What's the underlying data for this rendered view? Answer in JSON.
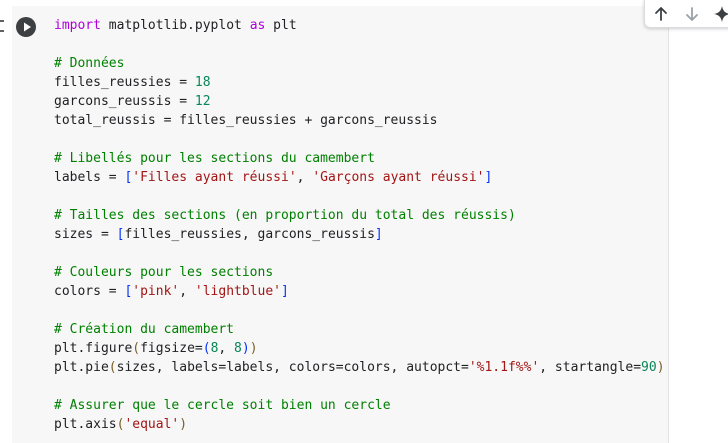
{
  "colors": {
    "cell_background": "#f7f7f7",
    "keyword": "#af00db",
    "comment": "#008000",
    "number": "#098658",
    "string": "#a31515",
    "bracket": "#0431fa",
    "paren": "#795e26"
  },
  "toolbar": {
    "icons": [
      "arrow-up-icon",
      "arrow-down-icon",
      "sparkle-icon"
    ]
  },
  "cell": {
    "run_icon": "play-icon",
    "code_lines": [
      [
        {
          "t": "kw",
          "v": "import"
        },
        {
          "t": "op",
          "v": " matplotlib.pyplot "
        },
        {
          "t": "kw",
          "v": "as"
        },
        {
          "t": "op",
          "v": " plt"
        }
      ],
      [],
      [
        {
          "t": "comment",
          "v": "# Données"
        }
      ],
      [
        {
          "t": "op",
          "v": "filles_reussies = "
        },
        {
          "t": "num",
          "v": "18"
        }
      ],
      [
        {
          "t": "op",
          "v": "garcons_reussis = "
        },
        {
          "t": "num",
          "v": "12"
        }
      ],
      [
        {
          "t": "op",
          "v": "total_reussis = filles_reussies + garcons_reussis"
        }
      ],
      [],
      [
        {
          "t": "comment",
          "v": "# Libellés pour les sections du camembert"
        }
      ],
      [
        {
          "t": "op",
          "v": "labels = "
        },
        {
          "t": "bracket",
          "v": "["
        },
        {
          "t": "str",
          "v": "'Filles ayant réussi'"
        },
        {
          "t": "op",
          "v": ", "
        },
        {
          "t": "str",
          "v": "'Garçons ayant réussi'"
        },
        {
          "t": "bracket",
          "v": "]"
        }
      ],
      [],
      [
        {
          "t": "comment",
          "v": "# Tailles des sections (en proportion du total des réussis)"
        }
      ],
      [
        {
          "t": "op",
          "v": "sizes = "
        },
        {
          "t": "bracket",
          "v": "["
        },
        {
          "t": "op",
          "v": "filles_reussies, garcons_reussis"
        },
        {
          "t": "bracket",
          "v": "]"
        }
      ],
      [],
      [
        {
          "t": "comment",
          "v": "# Couleurs pour les sections"
        }
      ],
      [
        {
          "t": "op",
          "v": "colors = "
        },
        {
          "t": "bracket",
          "v": "["
        },
        {
          "t": "str",
          "v": "'pink'"
        },
        {
          "t": "op",
          "v": ", "
        },
        {
          "t": "str",
          "v": "'lightblue'"
        },
        {
          "t": "bracket",
          "v": "]"
        }
      ],
      [],
      [
        {
          "t": "comment",
          "v": "# Création du camembert"
        }
      ],
      [
        {
          "t": "op",
          "v": "plt.figure"
        },
        {
          "t": "paren",
          "v": "("
        },
        {
          "t": "op",
          "v": "figsize="
        },
        {
          "t": "bracket",
          "v": "("
        },
        {
          "t": "num",
          "v": "8"
        },
        {
          "t": "op",
          "v": ", "
        },
        {
          "t": "num",
          "v": "8"
        },
        {
          "t": "bracket",
          "v": ")"
        },
        {
          "t": "paren",
          "v": ")"
        }
      ],
      [
        {
          "t": "op",
          "v": "plt.pie"
        },
        {
          "t": "paren",
          "v": "("
        },
        {
          "t": "op",
          "v": "sizes, labels=labels, colors=colors, autopct="
        },
        {
          "t": "str",
          "v": "'%1.1f%%'"
        },
        {
          "t": "op",
          "v": ", startangle="
        },
        {
          "t": "num",
          "v": "90"
        },
        {
          "t": "paren",
          "v": ")"
        }
      ],
      [],
      [
        {
          "t": "comment",
          "v": "# Assurer que le cercle soit bien un cercle"
        }
      ],
      [
        {
          "t": "op",
          "v": "plt.axis"
        },
        {
          "t": "paren",
          "v": "("
        },
        {
          "t": "str",
          "v": "'equal'"
        },
        {
          "t": "paren",
          "v": ")"
        }
      ]
    ]
  }
}
